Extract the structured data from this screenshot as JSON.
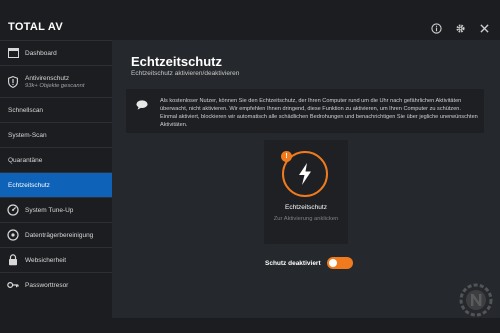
{
  "app": {
    "logo": "TOTAL AV"
  },
  "titlebar": {
    "icons": [
      "info-icon",
      "gear-icon",
      "close-icon"
    ]
  },
  "sidebar": {
    "items": [
      {
        "label": "Dashboard",
        "icon": "dashboard-icon"
      },
      {
        "label": "Antivirenschutz",
        "sub": "93k+ Objekte gescannt",
        "icon": "shield-icon"
      },
      {
        "label": "Schnellscan"
      },
      {
        "label": "System-Scan"
      },
      {
        "label": "Quarantäne"
      },
      {
        "label": "Echtzeitschutz",
        "active": true
      },
      {
        "label": "System Tune-Up",
        "icon": "speedometer-icon"
      },
      {
        "label": "Datenträgerbereinigung",
        "icon": "disk-icon"
      },
      {
        "label": "Websicherheit",
        "icon": "lock-icon"
      },
      {
        "label": "Passworttresor",
        "icon": "key-icon"
      }
    ]
  },
  "main": {
    "title": "Echtzeitschutz",
    "subtitle": "Echtzeitschutz aktivieren/deaktivieren",
    "info": "Als kostenloser Nutzer, können Sie den Echtzeitschutz, der Ihren Computer rund um die Uhr nach gefährlichen Aktivitäten überwacht, nicht aktivieren. Wir empfehlen Ihnen dringend, diese Funktion zu aktivieren, um Ihren Computer zu schützen. Einmal aktiviert, blockieren wir automatisch alle schädlichen Bedrohungen und benachrichtigen Sie über jegliche unerwünschten Aktivitäten.",
    "card": {
      "alert": "!",
      "title": "Echtzeitschutz",
      "subtitle": "Zur Aktivierung anklicken"
    },
    "toggle": {
      "label": "Schutz deaktiviert",
      "on": true
    }
  },
  "colors": {
    "accent": "#f07b1e",
    "active_nav": "#0e62b8",
    "background": "#1b1d20",
    "panel": "#25282c"
  }
}
